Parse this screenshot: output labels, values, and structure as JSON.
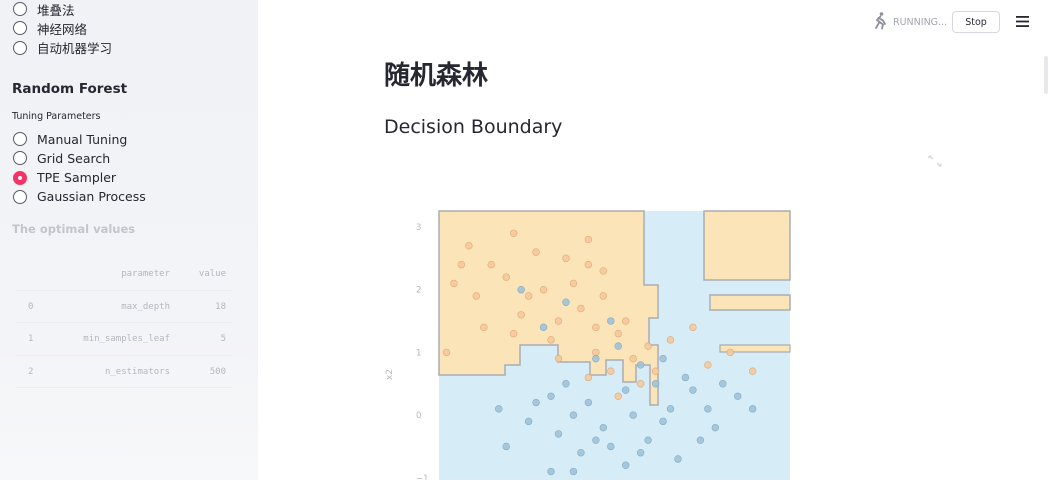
{
  "sidebar": {
    "top_options": [
      {
        "label": "堆叠法",
        "selected": false
      },
      {
        "label": "神经网络",
        "selected": false
      },
      {
        "label": "自动机器学习",
        "selected": false
      }
    ],
    "section_title": "Random Forest",
    "tuning_caption": "Tuning Parameters",
    "tuning_options": [
      {
        "label": "Manual Tuning",
        "selected": false
      },
      {
        "label": "Grid Search",
        "selected": false
      },
      {
        "label": "TPE Sampler",
        "selected": true
      },
      {
        "label": "Gaussian Process",
        "selected": false
      }
    ],
    "optimal_title": "The optimal values",
    "table": {
      "columns": [
        "",
        "parameter",
        "value"
      ],
      "rows": [
        [
          "0",
          "max_depth",
          "18"
        ],
        [
          "1",
          "min_samples_leaf",
          "5"
        ],
        [
          "2",
          "n_estimators",
          "500"
        ]
      ]
    }
  },
  "header": {
    "status_text": "RUNNING...",
    "stop_label": "Stop",
    "running_icon": "running-person-icon",
    "menu_icon": "hamburger-menu-icon"
  },
  "main": {
    "title": "随机森林",
    "subtitle": "Decision Boundary",
    "expand_icon": "fullscreen-icon"
  },
  "colors": {
    "accent": "#f63366",
    "class0_region": "#fbe4b8",
    "class1_region": "#d6ecf7",
    "class0_points": "#f7c999",
    "class1_points": "#9ec3da"
  },
  "chart_data": {
    "type": "scatter",
    "ylabel": "x2",
    "yticks": [
      "3",
      "2",
      "1",
      "0",
      "−1"
    ],
    "ylim": [
      -1.1,
      3.3
    ],
    "xlim": [
      -1.8,
      2.9
    ],
    "series": [
      {
        "points": [
          [
            -1.4,
            2.7
          ],
          [
            -1.1,
            2.4
          ],
          [
            -0.8,
            2.9
          ],
          [
            -0.5,
            2.6
          ],
          [
            -1.6,
            2.1
          ],
          [
            -1.3,
            1.9
          ],
          [
            -0.9,
            2.2
          ],
          [
            -0.4,
            2.0
          ],
          [
            -0.1,
            2.5
          ],
          [
            0.2,
            2.8
          ],
          [
            0.4,
            2.3
          ],
          [
            -1.7,
            1.0
          ],
          [
            -1.2,
            1.4
          ],
          [
            -0.7,
            1.6
          ],
          [
            -0.3,
            1.2
          ],
          [
            0.1,
            1.7
          ],
          [
            0.3,
            1.0
          ],
          [
            0.6,
            1.3
          ],
          [
            0.8,
            0.9
          ],
          [
            1.0,
            1.1
          ],
          [
            0.5,
            0.7
          ],
          [
            0.2,
            0.6
          ],
          [
            -0.2,
            0.9
          ],
          [
            0.0,
            2.1
          ],
          [
            0.7,
            1.5
          ],
          [
            1.3,
            1.2
          ],
          [
            1.8,
            0.8
          ],
          [
            2.1,
            1.0
          ],
          [
            2.4,
            0.7
          ],
          [
            1.6,
            1.4
          ],
          [
            -0.6,
            1.9
          ],
          [
            0.9,
            0.5
          ],
          [
            0.4,
            1.9
          ],
          [
            -0.2,
            1.5
          ],
          [
            1.1,
            0.7
          ],
          [
            0.6,
            0.3
          ],
          [
            0.2,
            2.4
          ],
          [
            -1.5,
            2.4
          ],
          [
            -0.8,
            1.3
          ],
          [
            0.3,
            1.4
          ]
        ]
      },
      {
        "points": [
          [
            -0.5,
            0.2
          ],
          [
            -0.2,
            -0.3
          ],
          [
            0.1,
            -0.6
          ],
          [
            0.4,
            -0.2
          ],
          [
            0.7,
            -0.8
          ],
          [
            1.0,
            -0.4
          ],
          [
            1.3,
            0.1
          ],
          [
            1.6,
            0.4
          ],
          [
            1.9,
            -0.2
          ],
          [
            2.2,
            0.3
          ],
          [
            -0.9,
            -0.5
          ],
          [
            -0.3,
            -0.9
          ],
          [
            0.2,
            0.2
          ],
          [
            0.5,
            -0.5
          ],
          [
            0.8,
            0.0
          ],
          [
            1.1,
            0.5
          ],
          [
            1.4,
            -0.7
          ],
          [
            -0.1,
            0.5
          ],
          [
            0.3,
            0.9
          ],
          [
            0.6,
            1.1
          ],
          [
            -0.4,
            1.4
          ],
          [
            -0.1,
            1.8
          ],
          [
            0.5,
            1.5
          ],
          [
            -0.7,
            2.0
          ],
          [
            0.9,
            0.8
          ],
          [
            1.2,
            0.9
          ],
          [
            1.5,
            0.6
          ],
          [
            2.0,
            0.5
          ],
          [
            2.4,
            0.1
          ],
          [
            -0.6,
            -0.1
          ],
          [
            0.0,
            -0.9
          ],
          [
            0.9,
            -0.6
          ],
          [
            1.7,
            -0.4
          ],
          [
            -1.0,
            0.1
          ],
          [
            0.3,
            -0.4
          ],
          [
            0.7,
            0.4
          ],
          [
            1.2,
            -0.1
          ],
          [
            -0.3,
            0.3
          ],
          [
            0.0,
            0.0
          ],
          [
            1.8,
            0.1
          ]
        ]
      }
    ]
  }
}
